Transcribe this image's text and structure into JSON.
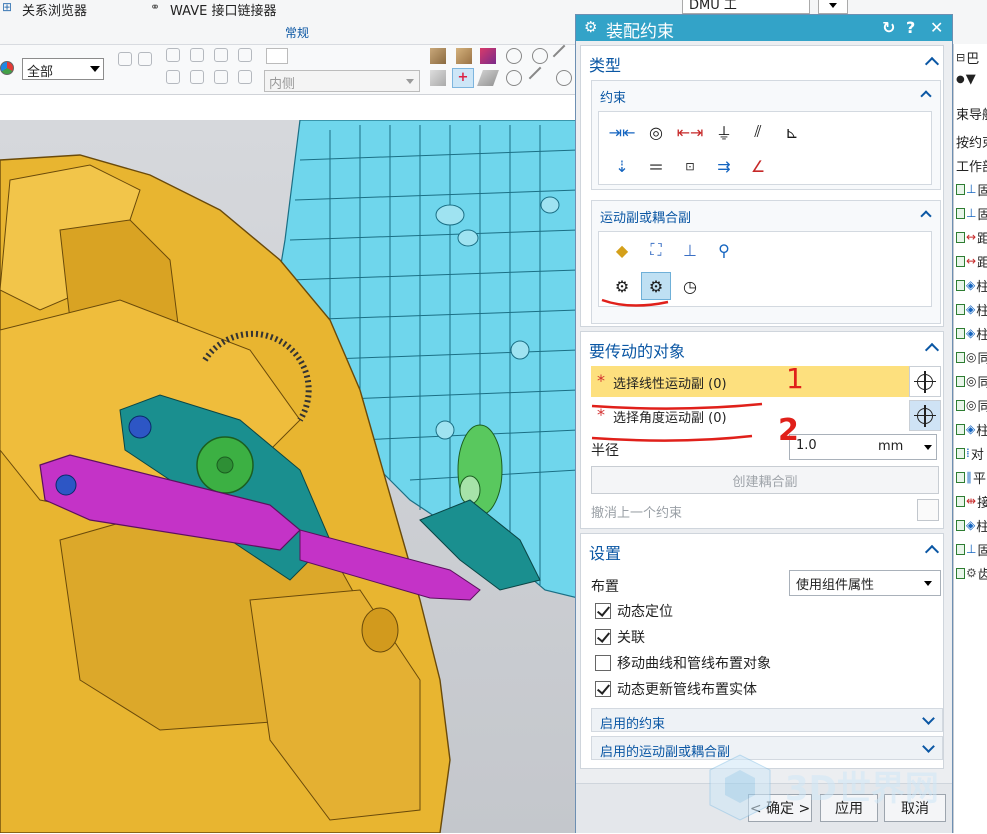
{
  "ribbon": {
    "top_left_label": "关系浏览器",
    "top_mid_label": "WAVE 接口链接器",
    "group_label": "常规",
    "filter_value": "全部",
    "inner_select_value": "内侧"
  },
  "dmu": {
    "value": "DMU 工"
  },
  "navigator": {
    "rows": [
      {
        "text": "巴",
        "icon": "layout-icon"
      },
      {
        "text": "▼",
        "icon": "dropdown-icon"
      },
      {
        "text": "束导航",
        "icon": ""
      },
      {
        "text": "按约束",
        "icon": ""
      },
      {
        "text": "工作部",
        "icon": ""
      },
      {
        "text": "固",
        "icon": "fix-icon"
      },
      {
        "text": "固",
        "icon": "fix-icon"
      },
      {
        "text": "距",
        "icon": "distance-icon"
      },
      {
        "text": "距",
        "icon": "distance-icon"
      },
      {
        "text": "柱",
        "icon": "cylinder-joint-icon"
      },
      {
        "text": "柱",
        "icon": "cylinder-joint-icon"
      },
      {
        "text": "柱",
        "icon": "cylinder-joint-icon"
      },
      {
        "text": "同",
        "icon": "concentric-icon"
      },
      {
        "text": "同",
        "icon": "concentric-icon"
      },
      {
        "text": "同",
        "icon": "concentric-icon"
      },
      {
        "text": "柱",
        "icon": "cylinder-joint-icon"
      },
      {
        "text": "对",
        "icon": "align-icon"
      },
      {
        "text": "平",
        "icon": "parallel-icon"
      },
      {
        "text": "接",
        "icon": "touch-icon"
      },
      {
        "text": "柱",
        "icon": "cylinder-joint-icon"
      },
      {
        "text": "固",
        "icon": "fix-icon"
      },
      {
        "text": "齿",
        "icon": "gear-icon"
      }
    ]
  },
  "dialog": {
    "title": "装配约束",
    "type_section": "类型",
    "constraint_subheader": "约束",
    "joint_subheader": "运动副或耦合副",
    "objects_section": "要传动的对象",
    "select_linear": "选择线性运动副 (0)",
    "select_angular": "选择角度运动副 (0)",
    "radius_label": "半径",
    "radius_value": "1.0",
    "radius_unit": "mm",
    "create_coupler": "创建耦合副",
    "undo_last": "撤消上一个约束",
    "settings_section": "设置",
    "layout_label": "布置",
    "layout_value": "使用组件属性",
    "checkboxes": [
      {
        "label": "动态定位",
        "checked": true
      },
      {
        "label": "关联",
        "checked": true
      },
      {
        "label": "移动曲线和管线布置对象",
        "checked": false
      },
      {
        "label": "动态更新管线布置实体",
        "checked": true
      }
    ],
    "enabled_constraints": "启用的约束",
    "enabled_joints": "启用的运动副或耦合副",
    "ok_button": "< 确定 >",
    "apply_button": "应用",
    "cancel_button": "取消"
  },
  "annotations": {
    "mark_1": "1",
    "mark_2": "2"
  },
  "watermark": {
    "text": "3D世界网"
  },
  "colors": {
    "title_bar": "#33a3c8",
    "accent_blue": "#0b57a4",
    "highlight_row": "#fde07e",
    "required_star": "#d32f2f",
    "model_gold": "#e8b530",
    "model_cyan": "#6fd6ec",
    "model_magenta": "#c433c7",
    "model_teal": "#1a8f8f",
    "model_green": "#3cb043"
  }
}
